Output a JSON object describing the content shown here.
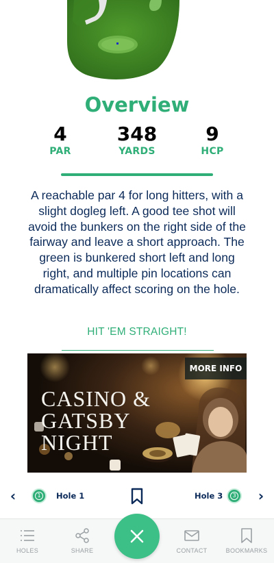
{
  "overview": {
    "title": "Overview",
    "stats": [
      {
        "value": "4",
        "label": "PAR"
      },
      {
        "value": "348",
        "label": "YARDS"
      },
      {
        "value": "9",
        "label": "HCP"
      }
    ],
    "description": "A reachable par 4 for long hitters, with a slight dogleg left. A good tee shot will avoid the bunkers on the right side of the fairway and leave a short approach. The green is bunkered short left and long right, and multiple pin locations can dramatically affect scoring on the hole.",
    "tagline": "HIT 'EM STRAIGHT!"
  },
  "ad": {
    "title_line1": "CASINO &",
    "title_line2": "GATSBY NIGHT",
    "button": "MORE INFO"
  },
  "hole_nav": {
    "prev_label": "Hole 1",
    "prev_badge": "1",
    "next_label": "Hole 3",
    "next_badge": "3",
    "prev_icon": "chevron-left-icon",
    "next_icon": "chevron-right-icon",
    "bookmark_icon": "bookmark-icon"
  },
  "tab_bar": {
    "holes": "HOLES",
    "share": "SHARE",
    "contact": "CONTACT",
    "bookmarks": "BOOKMARKS"
  },
  "colors": {
    "accent": "#2fae78",
    "text": "#0b2a59",
    "fab": "#3cc088"
  }
}
